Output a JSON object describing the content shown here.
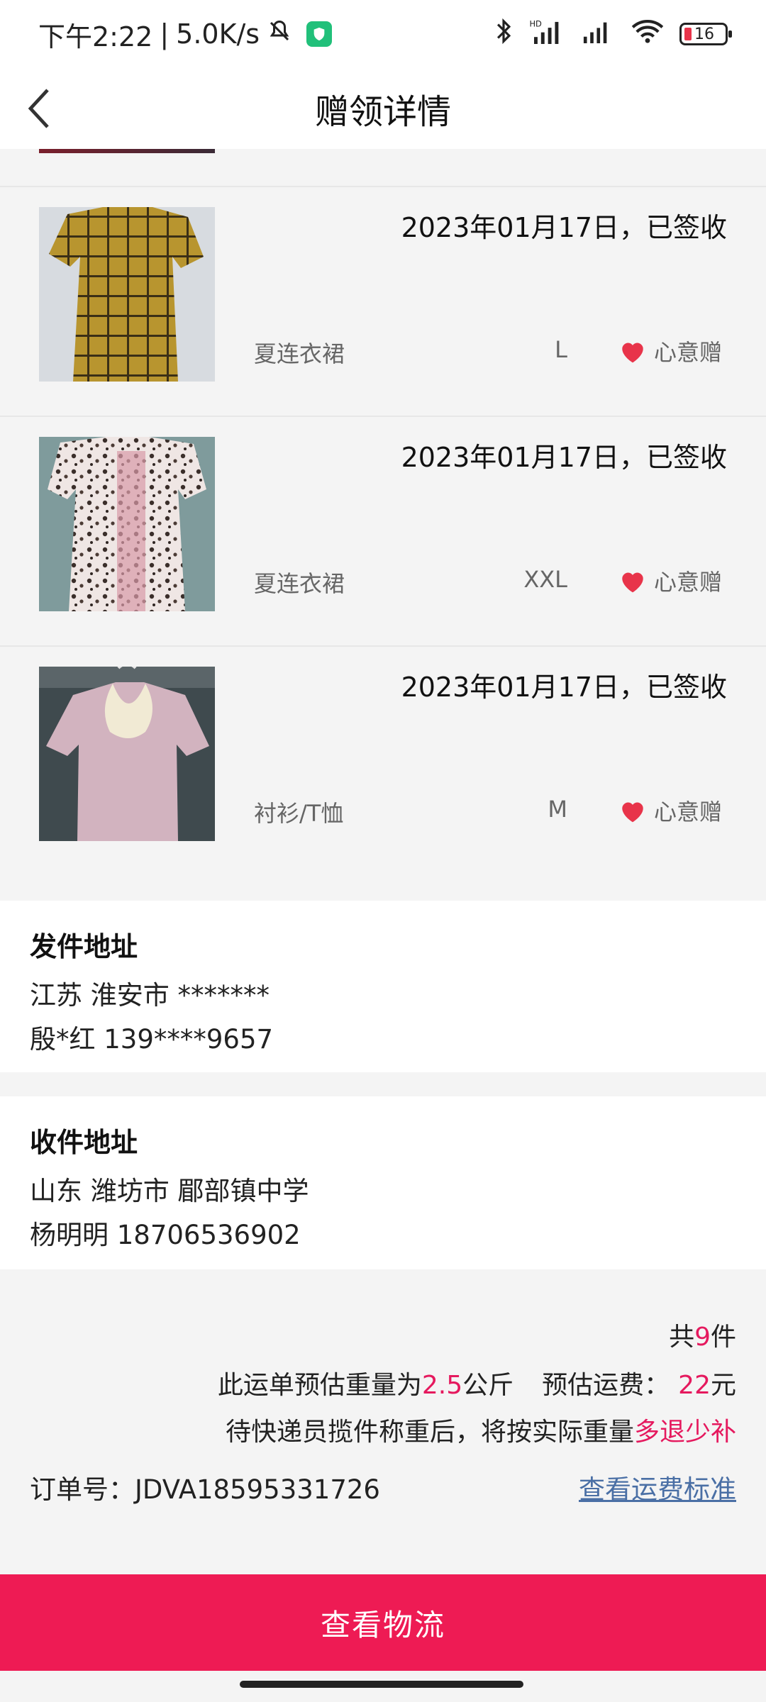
{
  "status_bar": {
    "time": "下午2:22",
    "speed": "5.0K/s",
    "battery": "16"
  },
  "header": {
    "title": "赠领详情"
  },
  "items": [
    {
      "date": "2023年01月17日，已签收",
      "category": "夏连衣裙",
      "size": "L",
      "tag": "心意赠"
    },
    {
      "date": "2023年01月17日，已签收",
      "category": "夏连衣裙",
      "size": "XXL",
      "tag": "心意赠"
    },
    {
      "date": "2023年01月17日，已签收",
      "category": "衬衫/T恤",
      "size": "M",
      "tag": "心意赠"
    }
  ],
  "sender": {
    "title": "发件地址",
    "address": "江苏 淮安市 *******",
    "contact": "殷*红 139****9657"
  },
  "receiver": {
    "title": "收件地址",
    "address": "山东 潍坊市 郿部镇中学",
    "contact": "杨明明 18706536902"
  },
  "summary": {
    "count_prefix": "共",
    "count": "9",
    "count_suffix": "件",
    "weight_prefix": "此运单预估重量为",
    "weight": "2.5",
    "weight_unit": "公斤",
    "fee_prefix": "预估运费：",
    "fee": "22",
    "fee_unit": "元",
    "note_prefix": "待快递员揽件称重后，将按实际重量",
    "note_highlight": "多退少补",
    "order_label": "订单号：JDVA18595331726",
    "fee_standard_link": "查看运费标准"
  },
  "cta_label": "查看物流",
  "colors": {
    "accent": "#ee1b54",
    "highlight": "#e5195e",
    "link": "#4a6fa5"
  }
}
